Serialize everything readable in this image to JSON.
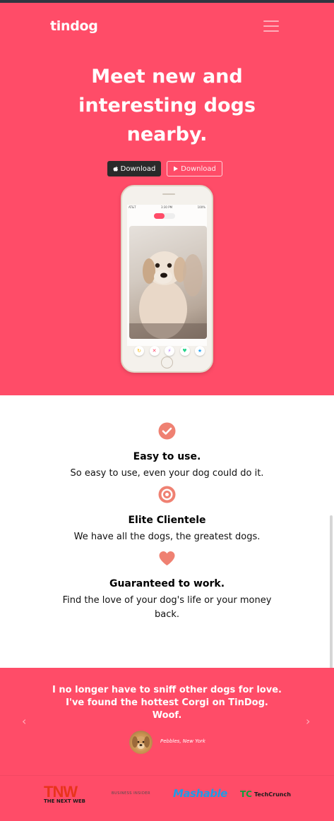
{
  "nav": {
    "brand": "tindog"
  },
  "hero": {
    "headline_lines": [
      "Meet new and",
      "interesting dogs",
      "nearby."
    ],
    "download_ios_label": "Download",
    "download_android_label": "Download",
    "phone_status": {
      "carrier": "AT&T",
      "time": "3:30 PM",
      "battery": "100%"
    }
  },
  "features": [
    {
      "icon": "check-circle-icon",
      "title": "Easy to use.",
      "text": "So easy to use, even your dog could do it."
    },
    {
      "icon": "target-icon",
      "title": "Elite Clientele",
      "text": "We have all the dogs, the greatest dogs."
    },
    {
      "icon": "heart-icon",
      "title": "Guaranteed to work.",
      "text_lines": [
        "Find the love of your dog's life or your money",
        "back."
      ]
    }
  ],
  "testimonial": {
    "quote_lines": [
      "I no longer have to sniff other dogs for love.",
      "I've found the hottest Corgi on TinDog.",
      "Woof."
    ],
    "attribution": "Pebbles, New York"
  },
  "press": {
    "tnw": {
      "mark": "TNW",
      "name": "THE NEXT WEB"
    },
    "business_insider": "BUSINESS INSIDER",
    "mashable": "Mashable",
    "techcrunch": {
      "mark": "TC",
      "name": "TechCrunch"
    }
  },
  "colors": {
    "brand": "#ff4c68",
    "feature_icon": "#ef8172",
    "dark_button": "#2a2a2a"
  }
}
